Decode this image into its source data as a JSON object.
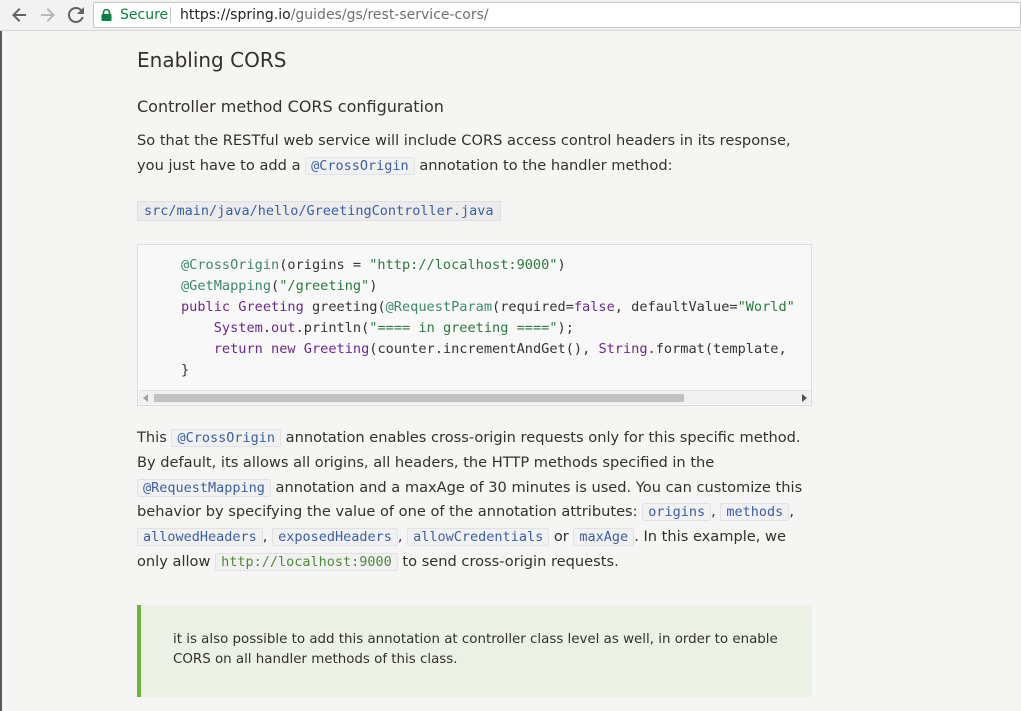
{
  "browser": {
    "secure_label": "Secure",
    "url_host": "https://spring.io",
    "url_path": "/guides/gs/rest-service-cors/"
  },
  "page": {
    "title": "Enabling CORS",
    "subtitle": "Controller method CORS configuration",
    "intro_part1": "So that the RESTful web service will include CORS access control headers in its response, you just have to add a ",
    "intro_code": "@CrossOrigin",
    "intro_part2": " annotation to the handler method:",
    "file_path": "src/main/java/hello/GreetingController.java",
    "code_lines": [
      "@CrossOrigin(origins = \"http://localhost:9000\")",
      "@GetMapping(\"/greeting\")",
      "public Greeting greeting(@RequestParam(required=false, defaultValue=\"World\"",
      "    System.out.println(\"==== in greeting ====\");",
      "    return new Greeting(counter.incrementAndGet(), String.format(template,",
      "}"
    ],
    "body": {
      "t1": "This ",
      "c1": "@CrossOrigin",
      "t2": " annotation enables cross-origin requests only for this specific method. By default, its allows all origins, all headers, the HTTP methods specified in the ",
      "c2": "@RequestMapping",
      "t3": " annotation and a maxAge of 30 minutes is used. You can customize this behavior by specifying the value of one of the annotation attributes: ",
      "c3": "origins",
      "t4": ", ",
      "c4": "methods",
      "t5": ", ",
      "c5": "allowedHeaders",
      "t6": ", ",
      "c6": "exposedHeaders",
      "t7": ", ",
      "c7": "allowCredentials",
      "t8": " or ",
      "c8": "maxAge",
      "t9": ". In this example, we only allow ",
      "c9": "http://localhost:9000",
      "t10": " to send cross-origin requests."
    },
    "note": "it is also possible to add this annotation at controller class level as well, in order to enable CORS on all handler methods of this class."
  },
  "colors": {
    "note_border": "#6db33f",
    "secure_green": "#0b8043",
    "code_link_blue": "#3a5fa3"
  },
  "icons": [
    "back-arrow-icon",
    "forward-arrow-icon",
    "reload-icon",
    "lock-icon"
  ]
}
